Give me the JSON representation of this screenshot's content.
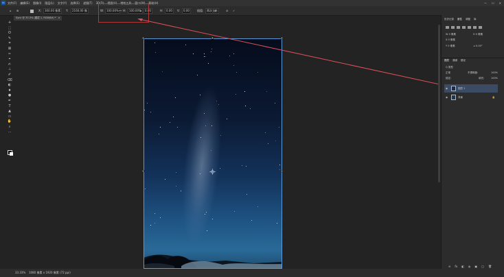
{
  "menubar": {
    "logo": "Ps",
    "items": [
      "文件(F)",
      "编辑(E)",
      "图像(I)",
      "图层(L)",
      "文字(Y)",
      "选择(S)",
      "滤镜(T)",
      "3D(D)",
      "视图(V)",
      "增效工具",
      "窗口(W)",
      "帮助(H)"
    ],
    "window_controls": [
      "—",
      "☐",
      "✕"
    ]
  },
  "options": {
    "x_label": "X:",
    "x_value": "300.00 像素",
    "y_label": "Y:",
    "y_value": "2160.00 像",
    "w_label": "W:",
    "w_value": "100.00%",
    "h_label": "H:",
    "h_value": "100.00%",
    "angle_label": "⊿",
    "angle_value": "0.00",
    "h_skew_label": "H:",
    "h_skew_value": "0.00",
    "v_skew_label": "V:",
    "v_skew_value": "0.00",
    "interp_label": "插值:",
    "interp_value": "两次立方",
    "cancel": "⊘",
    "commit": "✓"
  },
  "doc_tab": {
    "title": "Sync @ 33.3% (图层 1, RGB/8#) *",
    "close": "×"
  },
  "tools": [
    "✛",
    "⬚",
    "ʘ",
    "✎",
    "⌗",
    "⊠",
    "✑",
    "⌖",
    "✍",
    "⊥",
    "✐",
    "⌫",
    "◐",
    "♦",
    "●",
    "✒",
    "T",
    "▲",
    "▭",
    "✋",
    "⌕",
    "…"
  ],
  "statusbar": {
    "zoom": "33.33%",
    "info": "1080 像素 x 1920 像素 (72 ppi)"
  },
  "panel": {
    "top_tabs": [
      "历史记录",
      "属性",
      "调整",
      "库"
    ],
    "transform_lines": [
      "W 0 像素",
      "H 0 像素",
      "X 0 像素",
      "Y 0 像素",
      "⊿ 0.00°"
    ],
    "layer_tabs": [
      "图层",
      "通道",
      "路径"
    ],
    "search_placeholder": "Q 类型",
    "blend_mode": "正常",
    "opacity_label": "不透明度:",
    "opacity_value": "100%",
    "lock_label": "锁定:",
    "fill_label": "填充:",
    "fill_value": "100%",
    "layers": [
      {
        "name": "图层 1",
        "selected": true,
        "locked": false
      },
      {
        "name": "背景",
        "selected": false,
        "locked": true
      }
    ],
    "bottom_buttons": [
      "⊖",
      "fx",
      "◧",
      "◍",
      "▣",
      "▢",
      "🗑"
    ]
  },
  "colors": {
    "highlight": "#b33a3a",
    "arrow": "#e0505a",
    "transform": "#5a9ad8",
    "selection": "#3a4b63"
  }
}
